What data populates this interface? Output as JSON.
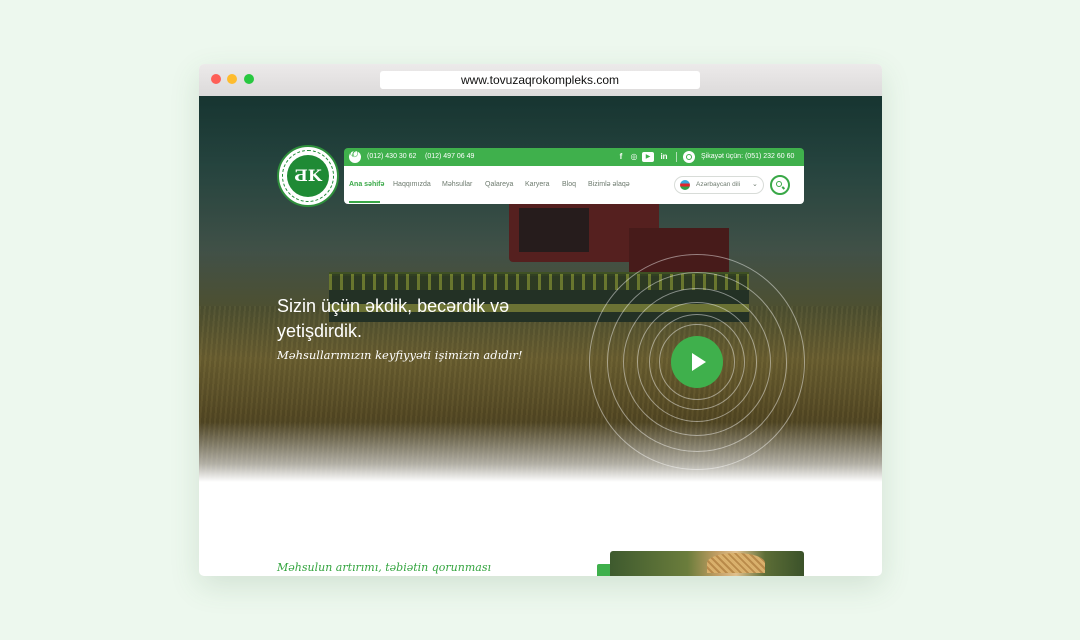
{
  "browser": {
    "url": "www.tovuzaqrokompleks.com"
  },
  "header": {
    "logo_text": "ƋK",
    "phones": [
      "(012) 430 30 62",
      "(012) 497 06 49"
    ],
    "social": [
      {
        "name": "facebook-icon",
        "glyph": "f"
      },
      {
        "name": "instagram-icon",
        "glyph": "◎"
      },
      {
        "name": "youtube-icon",
        "glyph": "▶"
      },
      {
        "name": "linkedin-icon",
        "glyph": "in"
      }
    ],
    "complaint_text": "Şikayət üçün: (051) 232 60 60",
    "nav": [
      "Ana səhifə",
      "Haqqımızda",
      "Məhsullar",
      "Qalareya",
      "Karyera",
      "Bloq",
      "Bizimlə əlaqə"
    ],
    "active_nav": "Ana səhifə",
    "language": "Azərbaycan dili"
  },
  "hero": {
    "title": "Sizin üçün əkdik, becərdik və yetişdirdik.",
    "subtitle": "Məhsullarımızın keyfiyyəti işimizin adıdır!"
  },
  "section": {
    "title": "Məhsulun artırımı, təbiətin qorunması"
  },
  "colors": {
    "brand_green": "#3fb04c",
    "page_bg": "#edf8ee"
  }
}
